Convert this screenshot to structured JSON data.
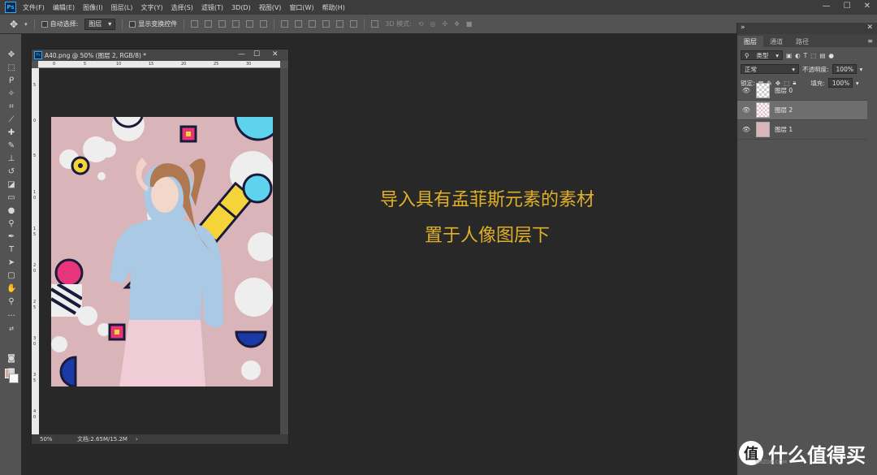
{
  "app": {
    "logo": "Ps"
  },
  "menubar": {
    "items": [
      "文件(F)",
      "编辑(E)",
      "图像(I)",
      "图层(L)",
      "文字(Y)",
      "选择(S)",
      "滤镜(T)",
      "3D(D)",
      "视图(V)",
      "窗口(W)",
      "帮助(H)"
    ],
    "window_controls": [
      "—",
      "☐",
      "✕"
    ]
  },
  "options": {
    "auto_select_label": "自动选择:",
    "auto_select_value": "图层",
    "show_transform_label": "显示变换控件",
    "mode_3d_label": "3D 模式:"
  },
  "document": {
    "title": "A40.png @ 50% (图层 2, RGB/8) *",
    "zoom": "50%",
    "status": "文档:2.65M/15.2M",
    "ruler_top": [
      "0",
      "5",
      "10",
      "15",
      "20",
      "25",
      "30"
    ],
    "ruler_left": [
      "5",
      "0",
      "5",
      "1",
      "0",
      "1",
      "5",
      "2",
      "0",
      "2",
      "5",
      "3",
      "0",
      "3",
      "5",
      "4",
      "0"
    ]
  },
  "overlay": {
    "line1": "导入具有孟菲斯元素的素材",
    "line2": "置于人像图层下"
  },
  "layers_panel": {
    "tabs": [
      "图层",
      "通道",
      "路径"
    ],
    "filter_type": "类型",
    "blend_mode": "正常",
    "opacity_label": "不透明度:",
    "opacity_value": "100%",
    "lock_label": "锁定:",
    "fill_label": "填充:",
    "fill_value": "100%",
    "layers": [
      {
        "name": "图层 0",
        "selected": false
      },
      {
        "name": "图层 2",
        "selected": true
      },
      {
        "name": "图层 1",
        "selected": false
      }
    ]
  },
  "watermark": {
    "text": "什么值得买",
    "small": "SMZDM.COM"
  },
  "colors": {
    "foreground": "#d4a9a5",
    "background": "#fafafa",
    "accent_text": "#e0b028",
    "image_bg": "#d9b4b8"
  }
}
